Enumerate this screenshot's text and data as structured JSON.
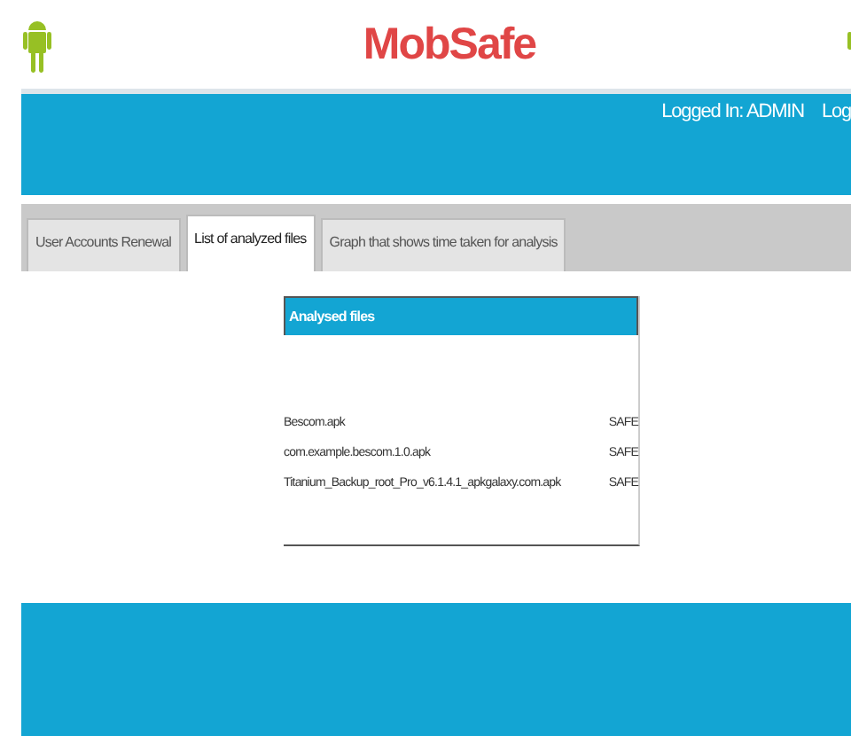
{
  "header": {
    "title": "MobSafe"
  },
  "nav": {
    "user": "Logged In: ADMIN",
    "logout": "Log"
  },
  "tabs": [
    {
      "label": "User Accounts Renewal",
      "selected": false
    },
    {
      "label": "List of analyzed files",
      "selected": true
    },
    {
      "label": "Graph that shows time taken for analysis",
      "selected": false
    }
  ],
  "panel": {
    "title": "Analysed files",
    "rows": [
      {
        "name": "Bescom.apk",
        "status": "SAFE"
      },
      {
        "name": "com.example.bescom.1.0.apk",
        "status": "SAFE"
      },
      {
        "name": "Titanium_Backup_root_Pro_v6.1.4.1_apkgalaxy.com.apk",
        "status": "SAFE"
      }
    ]
  }
}
